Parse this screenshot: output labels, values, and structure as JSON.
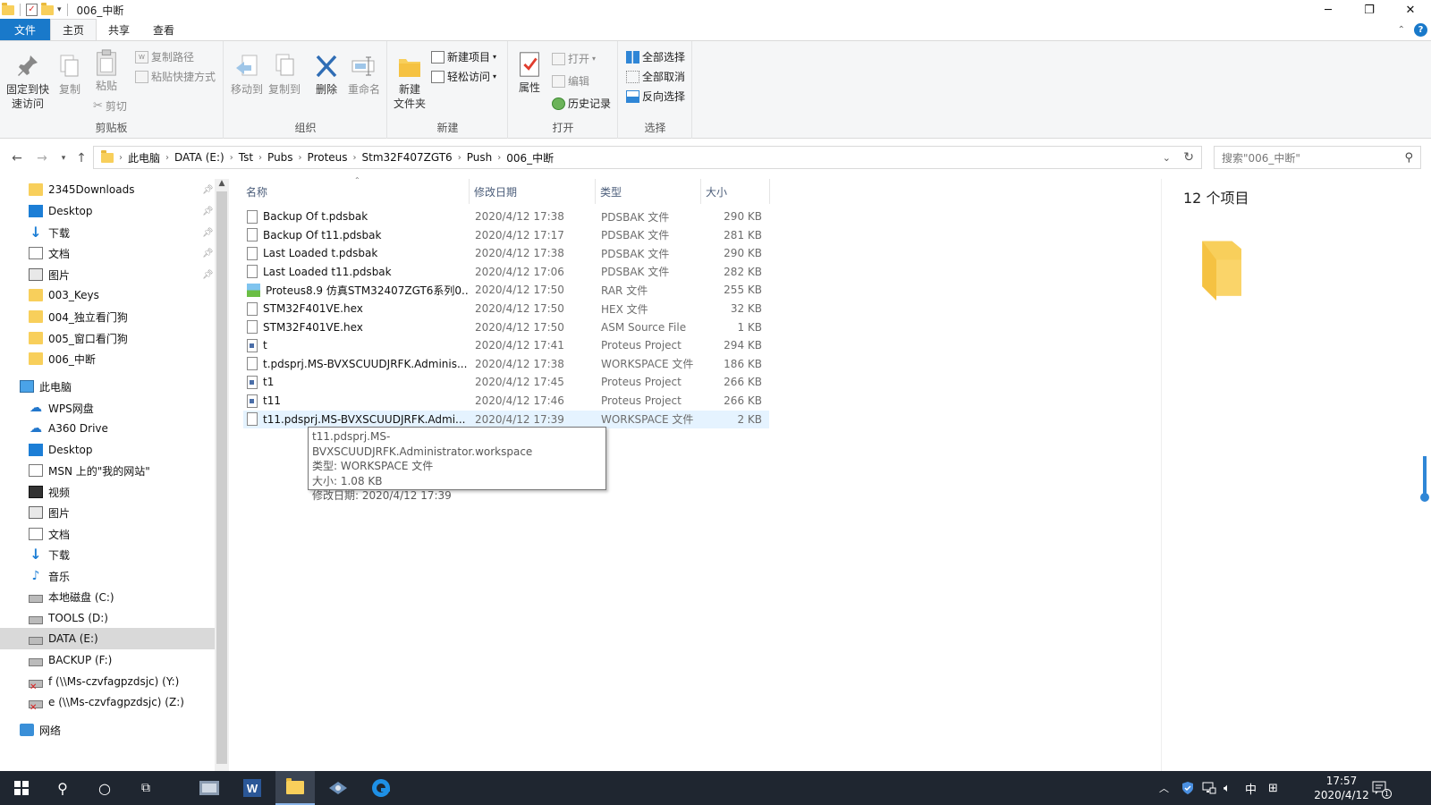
{
  "window": {
    "title": "006_中断",
    "controls": [
      "minimize-icon",
      "restore-icon",
      "close-icon"
    ]
  },
  "tabs": [
    {
      "label": "文件"
    },
    {
      "label": "主页"
    },
    {
      "label": "共享"
    },
    {
      "label": "查看"
    }
  ],
  "ribbon": {
    "clipboard": {
      "label": "剪贴板",
      "pin": "固定到快\n速访问",
      "copy": "复制",
      "paste": "粘贴",
      "copy_path": "复制路径",
      "paste_shortcut": "粘贴快捷方式",
      "cut": "剪切"
    },
    "organize": {
      "label": "组织",
      "move_to": "移动到",
      "copy_to": "复制到",
      "delete": "删除",
      "rename": "重命名"
    },
    "new": {
      "label": "新建",
      "new_folder": "新建\n文件夹",
      "new_item": "新建项目",
      "easy_access": "轻松访问"
    },
    "open": {
      "label": "打开",
      "properties": "属性",
      "open": "打开",
      "edit": "编辑",
      "history": "历史记录"
    },
    "select": {
      "label": "选择",
      "select_all": "全部选择",
      "select_none": "全部取消",
      "invert": "反向选择"
    }
  },
  "address": {
    "crumbs": [
      "此电脑",
      "DATA (E:)",
      "Tst",
      "Pubs",
      "Proteus",
      "Stm32F407ZGT6",
      "Push",
      "006_中断"
    ],
    "search_placeholder": "搜索\"006_中断\""
  },
  "nav": {
    "items": [
      {
        "label": "2345Downloads",
        "icon": "folder-icon",
        "pinned": true
      },
      {
        "label": "Desktop",
        "icon": "desktop-icon",
        "pinned": true
      },
      {
        "label": "下载",
        "icon": "download-icon",
        "pinned": true
      },
      {
        "label": "文档",
        "icon": "document-icon",
        "pinned": true
      },
      {
        "label": "图片",
        "icon": "picture-icon",
        "pinned": true
      },
      {
        "label": "003_Keys",
        "icon": "folder-icon"
      },
      {
        "label": "004_独立看门狗",
        "icon": "folder-icon"
      },
      {
        "label": "005_窗口看门狗",
        "icon": "folder-icon"
      },
      {
        "label": "006_中断",
        "icon": "folder-icon"
      },
      {
        "label": "此电脑",
        "icon": "this-pc-icon"
      },
      {
        "label": "WPS网盘",
        "icon": "cloud-icon"
      },
      {
        "label": "A360 Drive",
        "icon": "cloud-drive-icon"
      },
      {
        "label": "Desktop",
        "icon": "desktop-icon"
      },
      {
        "label": "MSN 上的\"我的网站\"",
        "icon": "document-icon"
      },
      {
        "label": "视频",
        "icon": "video-icon"
      },
      {
        "label": "图片",
        "icon": "picture-icon"
      },
      {
        "label": "文档",
        "icon": "document-icon"
      },
      {
        "label": "下载",
        "icon": "download-icon"
      },
      {
        "label": "音乐",
        "icon": "music-icon"
      },
      {
        "label": "本地磁盘 (C:)",
        "icon": "windows-drive-icon"
      },
      {
        "label": "TOOLS (D:)",
        "icon": "drive-icon"
      },
      {
        "label": "DATA (E:)",
        "icon": "drive-icon",
        "selected": true
      },
      {
        "label": "BACKUP (F:)",
        "icon": "drive-icon"
      },
      {
        "label": "f (\\\\Ms-czvfagpzdsjc) (Y:)",
        "icon": "disconnected-drive-icon"
      },
      {
        "label": "e (\\\\Ms-czvfagpzdsjc) (Z:)",
        "icon": "disconnected-drive-icon"
      },
      {
        "label": "网络",
        "icon": "network-icon"
      }
    ]
  },
  "columns": {
    "name": "名称",
    "date": "修改日期",
    "type": "类型",
    "size": "大小"
  },
  "files": [
    {
      "name": "Backup Of t.pdsbak",
      "date": "2020/4/12 17:38",
      "type": "PDSBAK 文件",
      "size": "290 KB",
      "icon": "file-icon"
    },
    {
      "name": "Backup Of t11.pdsbak",
      "date": "2020/4/12 17:17",
      "type": "PDSBAK 文件",
      "size": "281 KB",
      "icon": "file-icon"
    },
    {
      "name": "Last Loaded t.pdsbak",
      "date": "2020/4/12 17:38",
      "type": "PDSBAK 文件",
      "size": "290 KB",
      "icon": "file-icon"
    },
    {
      "name": "Last Loaded t11.pdsbak",
      "date": "2020/4/12 17:06",
      "type": "PDSBAK 文件",
      "size": "282 KB",
      "icon": "file-icon"
    },
    {
      "name": "Proteus8.9 仿真STM32407ZGT6系列0...",
      "date": "2020/4/12 17:50",
      "type": "RAR 文件",
      "size": "255 KB",
      "icon": "rar-icon"
    },
    {
      "name": "STM32F401VE.hex",
      "date": "2020/4/12 17:50",
      "type": "HEX 文件",
      "size": "32 KB",
      "icon": "file-icon"
    },
    {
      "name": "STM32F401VE.hex",
      "date": "2020/4/12 17:50",
      "type": "ASM Source File",
      "size": "1 KB",
      "icon": "file-icon"
    },
    {
      "name": "t",
      "date": "2020/4/12 17:41",
      "type": "Proteus Project",
      "size": "294 KB",
      "icon": "proteus-project-icon"
    },
    {
      "name": "t.pdsprj.MS-BVXSCUUDJRFK.Adminis...",
      "date": "2020/4/12 17:38",
      "type": "WORKSPACE 文件",
      "size": "186 KB",
      "icon": "file-icon"
    },
    {
      "name": "t1",
      "date": "2020/4/12 17:45",
      "type": "Proteus Project",
      "size": "266 KB",
      "icon": "proteus-project-icon"
    },
    {
      "name": "t11",
      "date": "2020/4/12 17:46",
      "type": "Proteus Project",
      "size": "266 KB",
      "icon": "proteus-project-icon"
    },
    {
      "name": "t11.pdsprj.MS-BVXSCUUDJRFK.Admi...",
      "date": "2020/4/12 17:39",
      "type": "WORKSPACE 文件",
      "size": "2 KB",
      "icon": "file-icon",
      "hover": true
    }
  ],
  "tooltip": {
    "line1": "t11.pdsprj.MS-BVXSCUUDJRFK.Administrator.workspace",
    "line2": "类型: WORKSPACE 文件",
    "line3": "大小: 1.08 KB",
    "line4": "修改日期: 2020/4/12 17:39"
  },
  "preview": {
    "count": "12 个项目"
  },
  "taskbar": {
    "ime": "中",
    "time": "17:57",
    "date": "2020/4/12",
    "notification_count": "1"
  },
  "colors": {
    "accent": "#1979ca",
    "ribbon_bg": "#f5f6f7",
    "folder": "#f8cf5b",
    "taskbar": "#1f2630",
    "hover_row": "#e5f3ff"
  }
}
